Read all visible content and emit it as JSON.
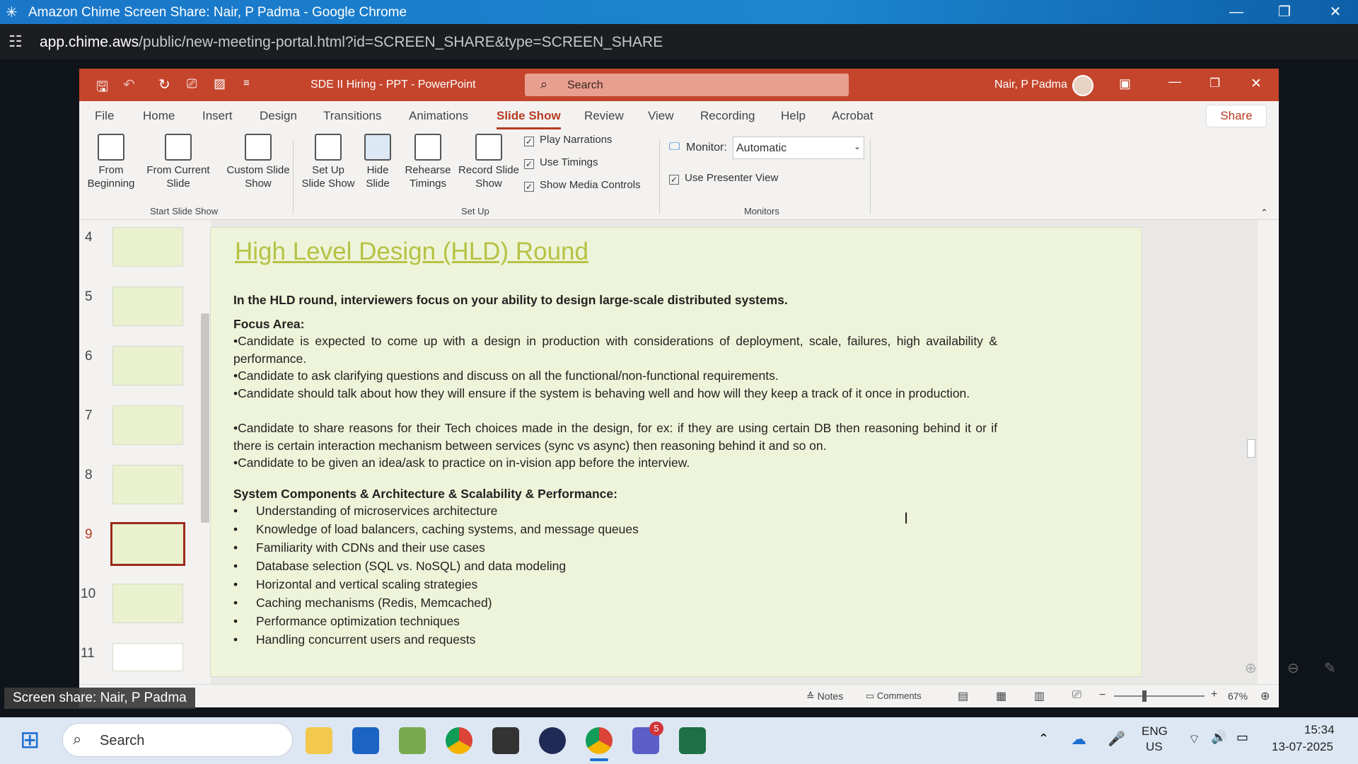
{
  "chrome": {
    "title": "Amazon Chime Screen Share: Nair, P Padma - Google Chrome",
    "url_host": "app.chime.aws",
    "url_path": "/public/new-meeting-portal.html?id=SCREEN_SHARE&type=SCREEN_SHARE"
  },
  "ppt": {
    "doc_title": "SDE II Hiring - PPT  -  PowerPoint",
    "search_placeholder": "Search",
    "user": "Nair, P Padma",
    "share": "Share",
    "tabs": [
      "File",
      "Home",
      "Insert",
      "Design",
      "Transitions",
      "Animations",
      "Slide Show",
      "Review",
      "View",
      "Recording",
      "Help",
      "Acrobat"
    ],
    "ribbon": {
      "from_beginning": "From Beginning",
      "from_current": "From Current Slide",
      "custom_show": "Custom Slide Show",
      "setup": "Set Up Slide Show",
      "hide": "Hide Slide",
      "rehearse": "Rehearse Timings",
      "record": "Record Slide Show",
      "play_narrations": "Play Narrations",
      "use_timings": "Use Timings",
      "show_media": "Show Media Controls",
      "monitor_label": "Monitor:",
      "monitor_value": "Automatic",
      "presenter_view": "Use Presenter View",
      "group_start": "Start Slide Show",
      "group_setup": "Set Up",
      "group_monitors": "Monitors"
    },
    "thumb_numbers": [
      "4",
      "5",
      "6",
      "7",
      "8",
      "9",
      "10",
      "11"
    ],
    "slide": {
      "title": "High Level Design (HLD) Round",
      "intro": "In the HLD round, interviewers focus on your ability to design large-scale distributed systems.",
      "focus_heading": "Focus Area:",
      "focus_items": [
        "•Candidate is expected to come up with a design in production with considerations of deployment, scale, failures, high availability & performance.",
        "•Candidate to ask clarifying questions and discuss on all the functional/non-functional requirements.",
        "•Candidate should talk about how they will ensure if the system is behaving well and how will they keep a track of it once in production.",
        "•Candidate to share reasons for their Tech choices made in the design, for ex: if they are using certain DB then reasoning behind it or if there is certain interaction mechanism between services (sync vs async) then reasoning behind it and so on.",
        "•Candidate to be given an idea/ask to practice on in-vision app before the interview."
      ],
      "components_heading": "System Components & Architecture & Scalability & Performance:",
      "components": [
        "Understanding of microservices architecture",
        "Knowledge of load balancers, caching systems, and message queues",
        "Familiarity with CDNs and their use cases",
        "Database selection (SQL vs. NoSQL) and data modeling",
        "Horizontal and vertical scaling strategies",
        "Caching mechanisms (Redis, Memcached)",
        "Performance optimization techniques",
        "Handling concurrent users and requests"
      ]
    },
    "status": {
      "notes": "Notes",
      "comments": "Comments",
      "zoom": "67%"
    }
  },
  "banner": "Screen share: Nair, P Padma",
  "taskbar": {
    "search": "Search",
    "lang1": "ENG",
    "lang2": "US",
    "time": "15:34",
    "date": "13-07-2025",
    "teams_badge": "5"
  }
}
